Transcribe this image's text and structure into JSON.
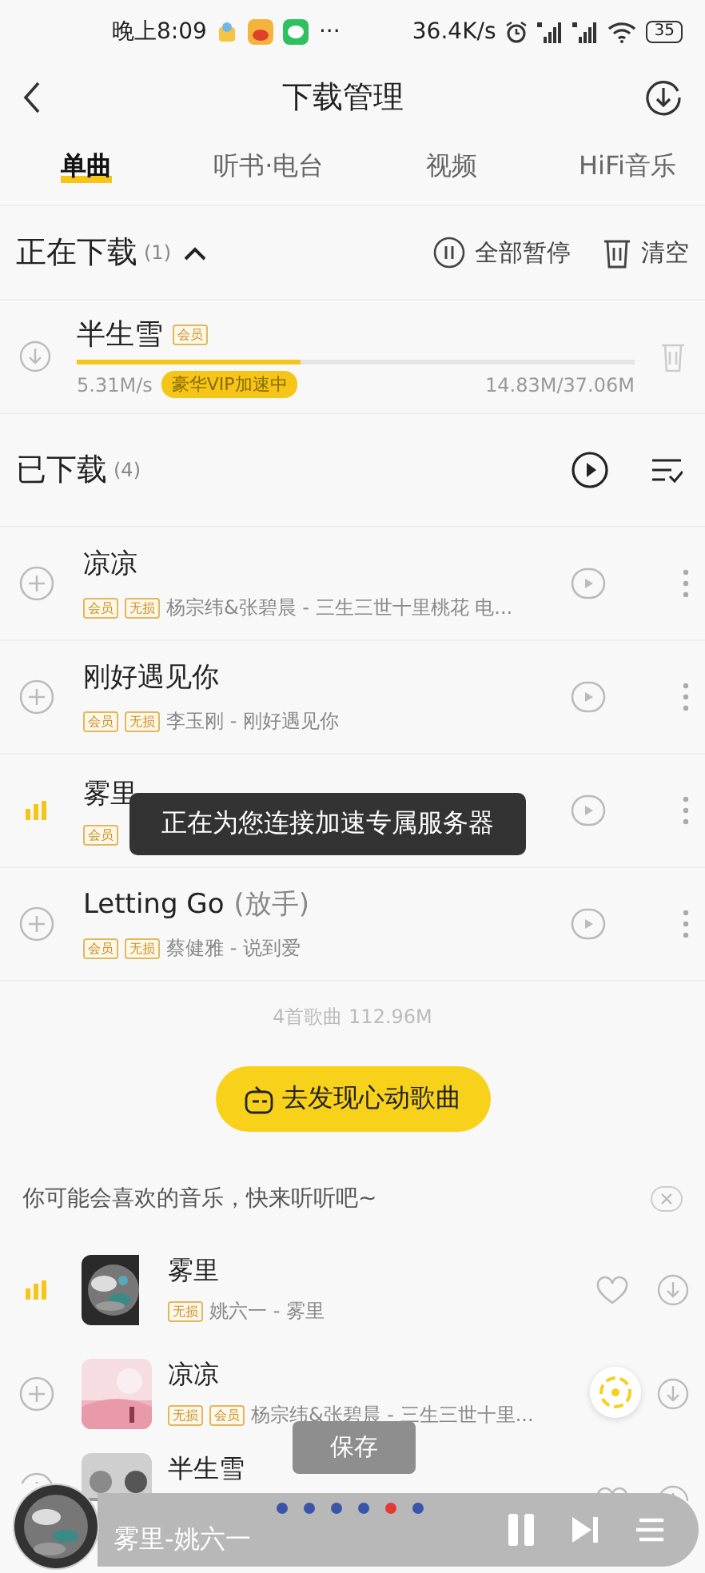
{
  "status_bar": {
    "time": "晚上8:09",
    "more": "···",
    "speed": "36.4K/s",
    "battery": "35"
  },
  "header": {
    "title": "下载管理"
  },
  "tabs": [
    {
      "label": "单曲",
      "selected": true
    },
    {
      "label": "听书·电台",
      "selected": false
    },
    {
      "label": "视频",
      "selected": false
    },
    {
      "label": "HiFi音乐",
      "selected": false
    }
  ],
  "downloading": {
    "title": "正在下载",
    "count": "(1)",
    "expanded": true,
    "pause_all": "全部暂停",
    "clear": "清空",
    "items": [
      {
        "title": "半生雪",
        "badges": [
          "会员"
        ],
        "level": 0.4,
        "speed": "5.31M/s",
        "vip": "豪华VIP加速中",
        "size": "14.83M/37.06M"
      }
    ]
  },
  "downloaded": {
    "title": "已下载",
    "count": "(4)",
    "songs": [
      {
        "title": "凉凉",
        "badges": [
          "会员",
          "无损"
        ],
        "subtitle": "杨宗纬&张碧晨 - 三生三世十里桃花 电...",
        "playing": false
      },
      {
        "title": "刚好遇见你",
        "badges": [
          "会员",
          "无损"
        ],
        "subtitle": "李玉刚 - 刚好遇见你",
        "playing": false
      },
      {
        "title": "雾里",
        "badges": [
          "会员"
        ],
        "playing": true
      },
      {
        "title": "Letting Go",
        "note": "(放手)",
        "badges": [
          "会员",
          "无损"
        ],
        "subtitle": "蔡健雅 - 说到爱",
        "playing": false
      }
    ],
    "summary": "4首歌曲 112.96M"
  },
  "toast": "正在为您连接加速专属服务器",
  "discover_button": "去发现心动歌曲",
  "recommend": {
    "title": "你可能会喜欢的音乐，快来听听吧~",
    "songs": [
      {
        "title": "雾里",
        "badges": [
          "无损"
        ],
        "subtitle": "姚六一 - 雾里",
        "playing": true
      },
      {
        "title": "凉凉",
        "badges": [
          "无损",
          "会员"
        ],
        "subtitle": "杨宗纬&张碧晨 - 三生三世十里...",
        "playing": false
      },
      {
        "title": "半生雪",
        "playing": false
      }
    ]
  },
  "save_button": "保存",
  "player": {
    "title": "雾里-姚六一",
    "playing": true,
    "pages": [
      {
        "selected": false
      },
      {
        "selected": false
      },
      {
        "selected": false
      },
      {
        "selected": false
      },
      {
        "selected": true
      },
      {
        "selected": false
      }
    ]
  }
}
